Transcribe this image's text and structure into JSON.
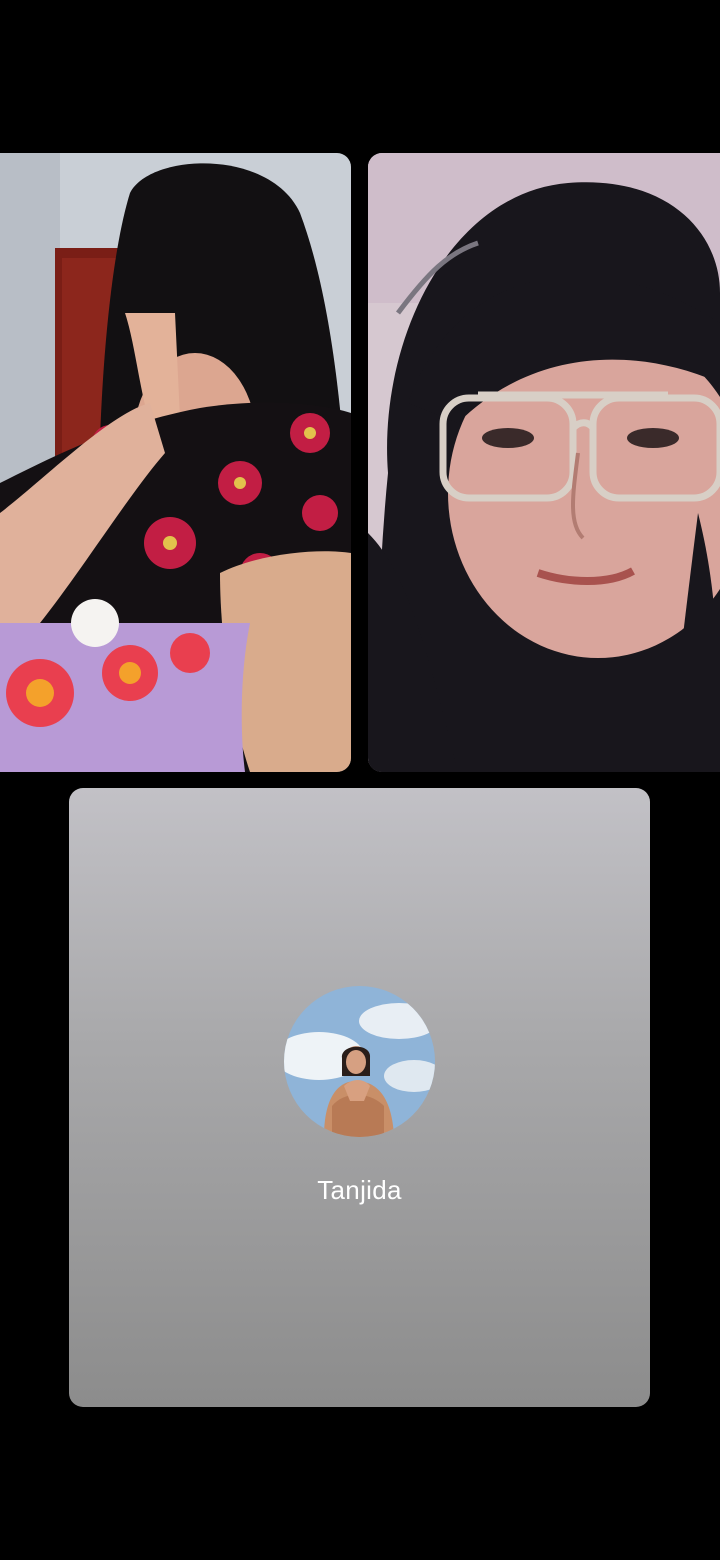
{
  "participants": [
    {
      "kind": "video"
    },
    {
      "kind": "video"
    },
    {
      "kind": "avatar",
      "name": "Tanjida"
    }
  ],
  "colors": {
    "background": "#000000",
    "tile_gray_top": "#c2c1c6",
    "tile_gray_bottom": "#8c8c8c",
    "name_text": "#ffffff"
  }
}
